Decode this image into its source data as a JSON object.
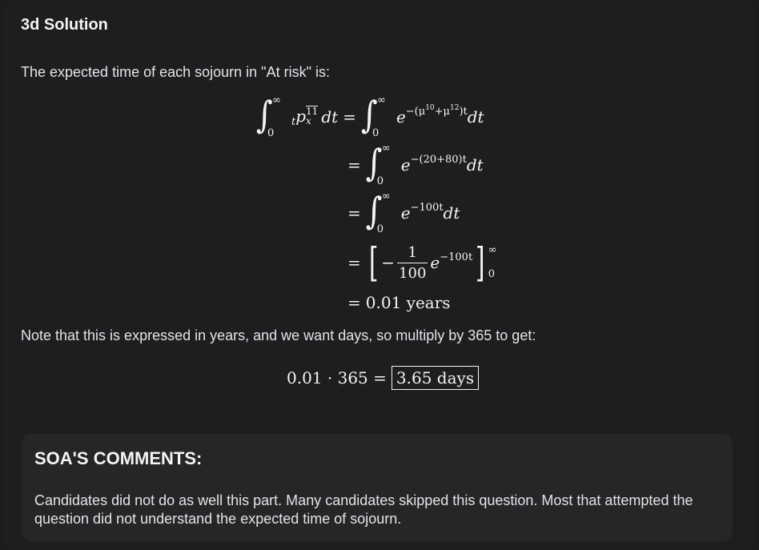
{
  "section_title": "3d Solution",
  "intro_text": "The expected time of each sojourn in \"At risk\" is:",
  "equations": {
    "infinity": "∞",
    "zero": "0",
    "lhs_t": "t",
    "lhs_p": "p",
    "lhs_state": "11",
    "lhs_x": "x",
    "dt": "dt",
    "equals": "=",
    "e": "e",
    "line1_exponent_prefix": "−(μ",
    "mu10": "10",
    "plus": "+μ",
    "mu12": "12",
    "line1_exponent_suffix": ")t",
    "line2_exponent": "−(20+80)t",
    "line3_exponent": "−100t",
    "line4_minus": "−",
    "line4_num": "1",
    "line4_den": "100",
    "line4_exponent": "−100t",
    "line5_result": "0.01 years"
  },
  "note_text": "Note that this is expressed in years, and we want days, so multiply by 365 to get:",
  "final_result": {
    "expression": "0.01 · 365 =",
    "boxed_answer": "3.65 days"
  },
  "comments": {
    "title": "SOA'S COMMENTS:",
    "text": "Candidates did not do as well this part. Many candidates skipped this question. Most that attempted the question did not understand the expected time of sojourn."
  }
}
